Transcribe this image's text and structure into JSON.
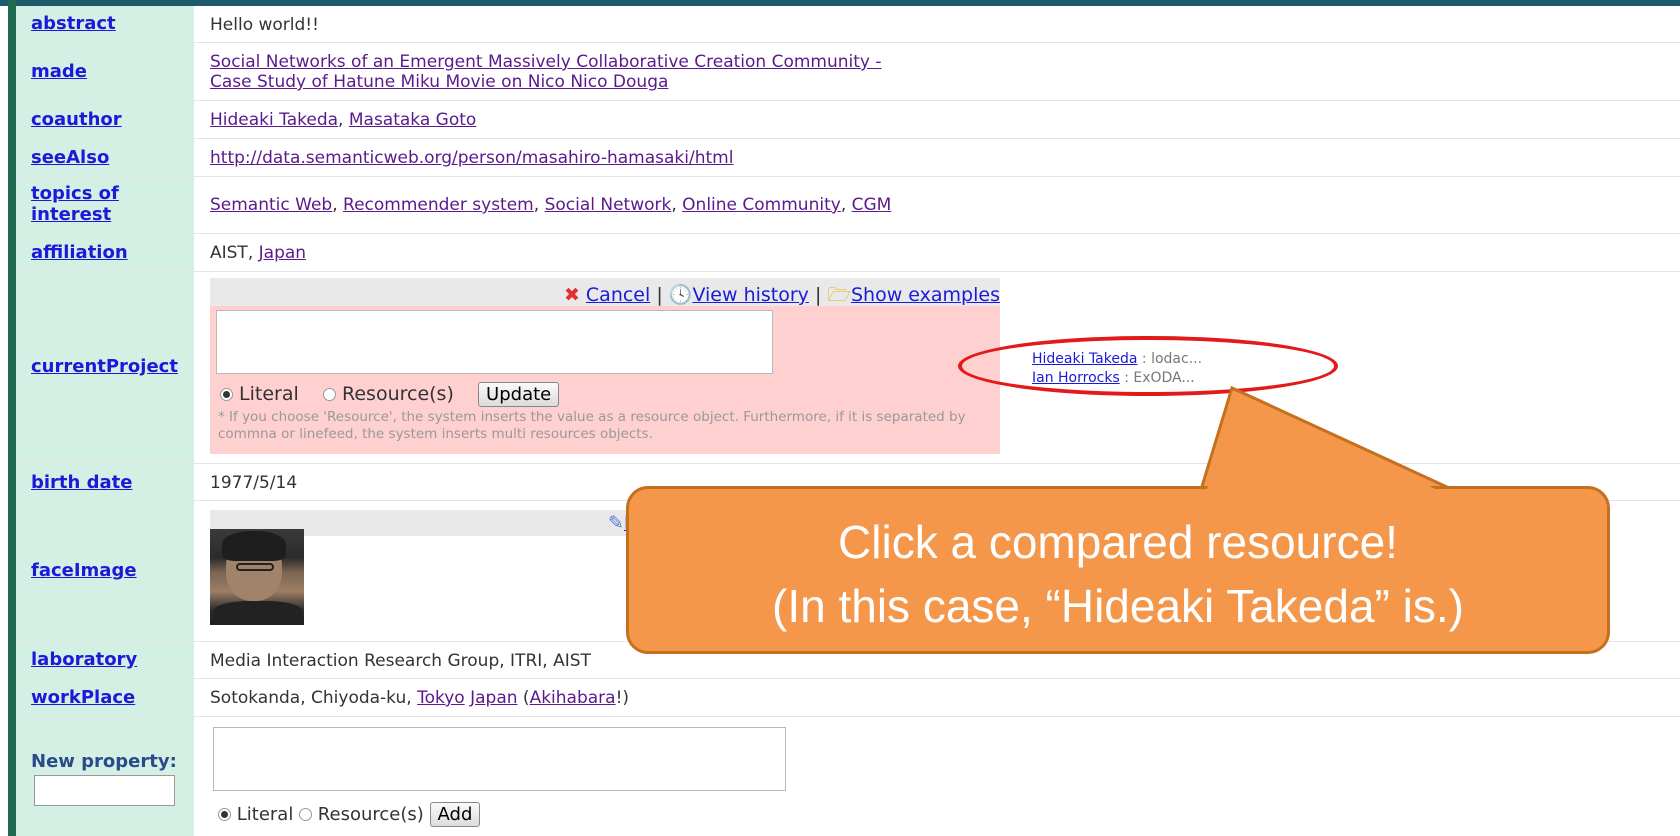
{
  "rows": {
    "abstract": {
      "key": "abstract",
      "value": "Hello world!!"
    },
    "made": {
      "key": "made",
      "line1": "Social Networks of an Emergent Massively Collaborative Creation Community -",
      "line2": "Case Study of Hatune Miku Movie on Nico Nico Douga"
    },
    "coauthor": {
      "key": "coauthor",
      "links": [
        "Hideaki Takeda",
        "Masataka Goto"
      ],
      "sep": ", "
    },
    "seeAlso": {
      "key": "seeAlso",
      "url": "http://data.semanticweb.org/person/masahiro-hamasaki/html"
    },
    "topics": {
      "key_line1": "topics of",
      "key_line2": "interest",
      "links": [
        "Semantic Web",
        "Recommender system",
        "Social Network",
        "Online Community",
        "CGM"
      ]
    },
    "affiliation": {
      "key": "affiliation",
      "text": "AIST, ",
      "link": "Japan"
    },
    "currentProject": {
      "key": "currentProject",
      "cancel": "Cancel",
      "view_history": "View history",
      "show_examples": "Show examples",
      "sep": "|",
      "radio_literal": "Literal",
      "radio_resource": "Resource(s)",
      "update": "Update",
      "note": "* If you choose 'Resource', the system inserts the value as a resource object. Furthermore, if it is separated by commna or linefeed, the system inserts multi resources objects.",
      "compared": [
        {
          "name": "Hideaki Takeda",
          "detail": " : lodac..."
        },
        {
          "name": "Ian Horrocks",
          "detail": " : ExODA..."
        }
      ]
    },
    "birth": {
      "key": "birth date",
      "value": "1977/5/14"
    },
    "faceImage": {
      "key": "faceImage",
      "edit_partial": "E"
    },
    "laboratory": {
      "key": "laboratory",
      "value": "Media Interaction Research Group, ITRI, AIST"
    },
    "workPlace": {
      "key": "workPlace",
      "text1": "Sotokanda, Chiyoda-ku, ",
      "link_tokyo": "Tokyo",
      "link_japan": "Japan",
      "paren_open": " (",
      "link_akiba": "Akihabara",
      "paren_close": "!)"
    },
    "newProperty": {
      "label": "New property:",
      "radio_literal": "Literal",
      "radio_resource": "Resource(s)",
      "add": "Add"
    }
  },
  "callout": {
    "line1": "Click a compared resource!",
    "line2": "(In this case, “Hideaki Takeda” is.)",
    "fill": "#f4974a",
    "ellipse_color": "#e31a1a"
  },
  "icons": [
    "cancel-x-icon",
    "clock-icon",
    "folder-icon",
    "pencil-icon"
  ]
}
